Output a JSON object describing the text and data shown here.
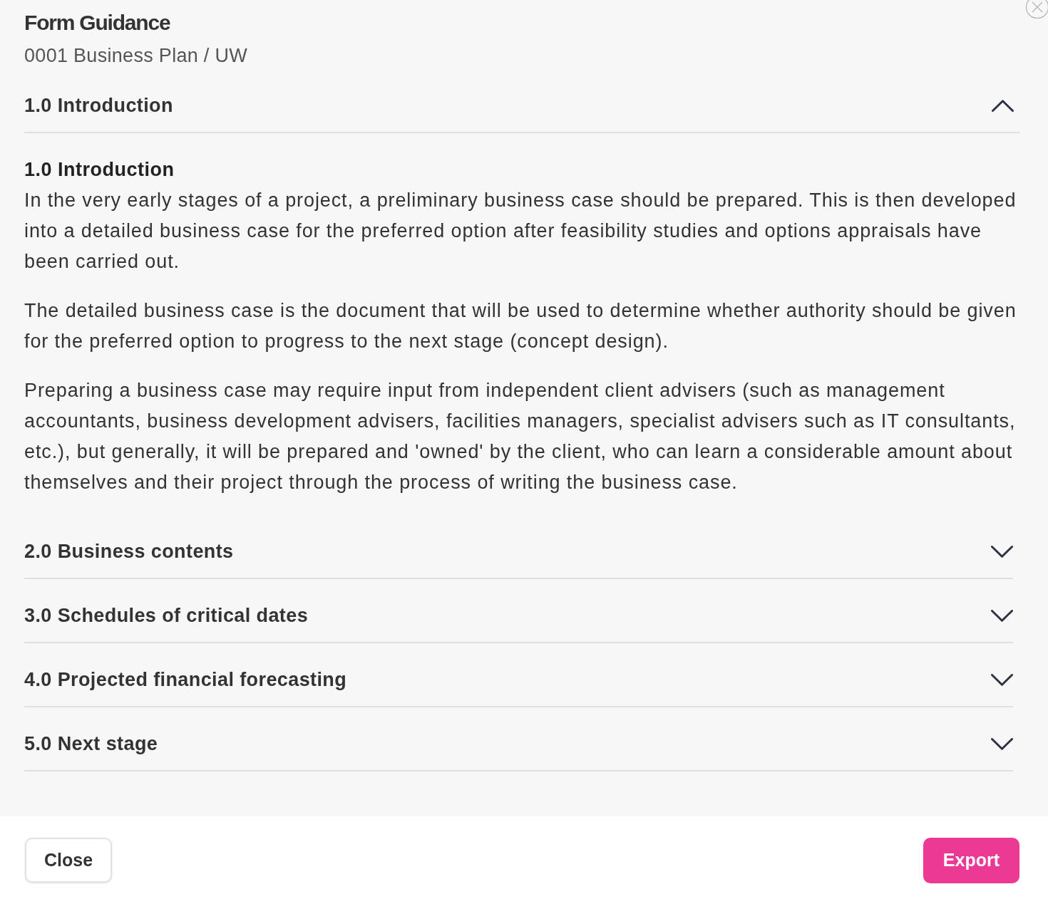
{
  "dialog": {
    "title": "Form Guidance",
    "subtitle": "0001 Business Plan / UW"
  },
  "sections": [
    {
      "title": "1.0 Introduction",
      "expanded": true,
      "content": {
        "heading": "1.0 Introduction",
        "paragraphs": [
          "In the very early stages of a project, a preliminary business case should be prepared. This is then developed into a detailed business case for the preferred option after feasibility studies and options appraisals have been carried out.",
          "The detailed business case is the document that will be used to determine whether authority should be given for the preferred option to progress to the next stage (concept design).",
          "Preparing a business case may require input from independent client advisers (such as management accountants, business development advisers, facilities managers, specialist advisers such as IT consultants, etc.), but generally, it will be prepared and 'owned' by the client, who can learn a considerable amount about themselves and their project through the process of writing the business case."
        ]
      }
    },
    {
      "title": "2.0 Business contents",
      "expanded": false
    },
    {
      "title": "3.0 Schedules of critical dates",
      "expanded": false
    },
    {
      "title": "4.0 Projected financial forecasting",
      "expanded": false
    },
    {
      "title": "5.0 Next stage",
      "expanded": false
    }
  ],
  "footer": {
    "buttons": [
      {
        "label": "Close",
        "kind": "secondary"
      },
      {
        "label": "Export",
        "kind": "primary"
      }
    ]
  }
}
